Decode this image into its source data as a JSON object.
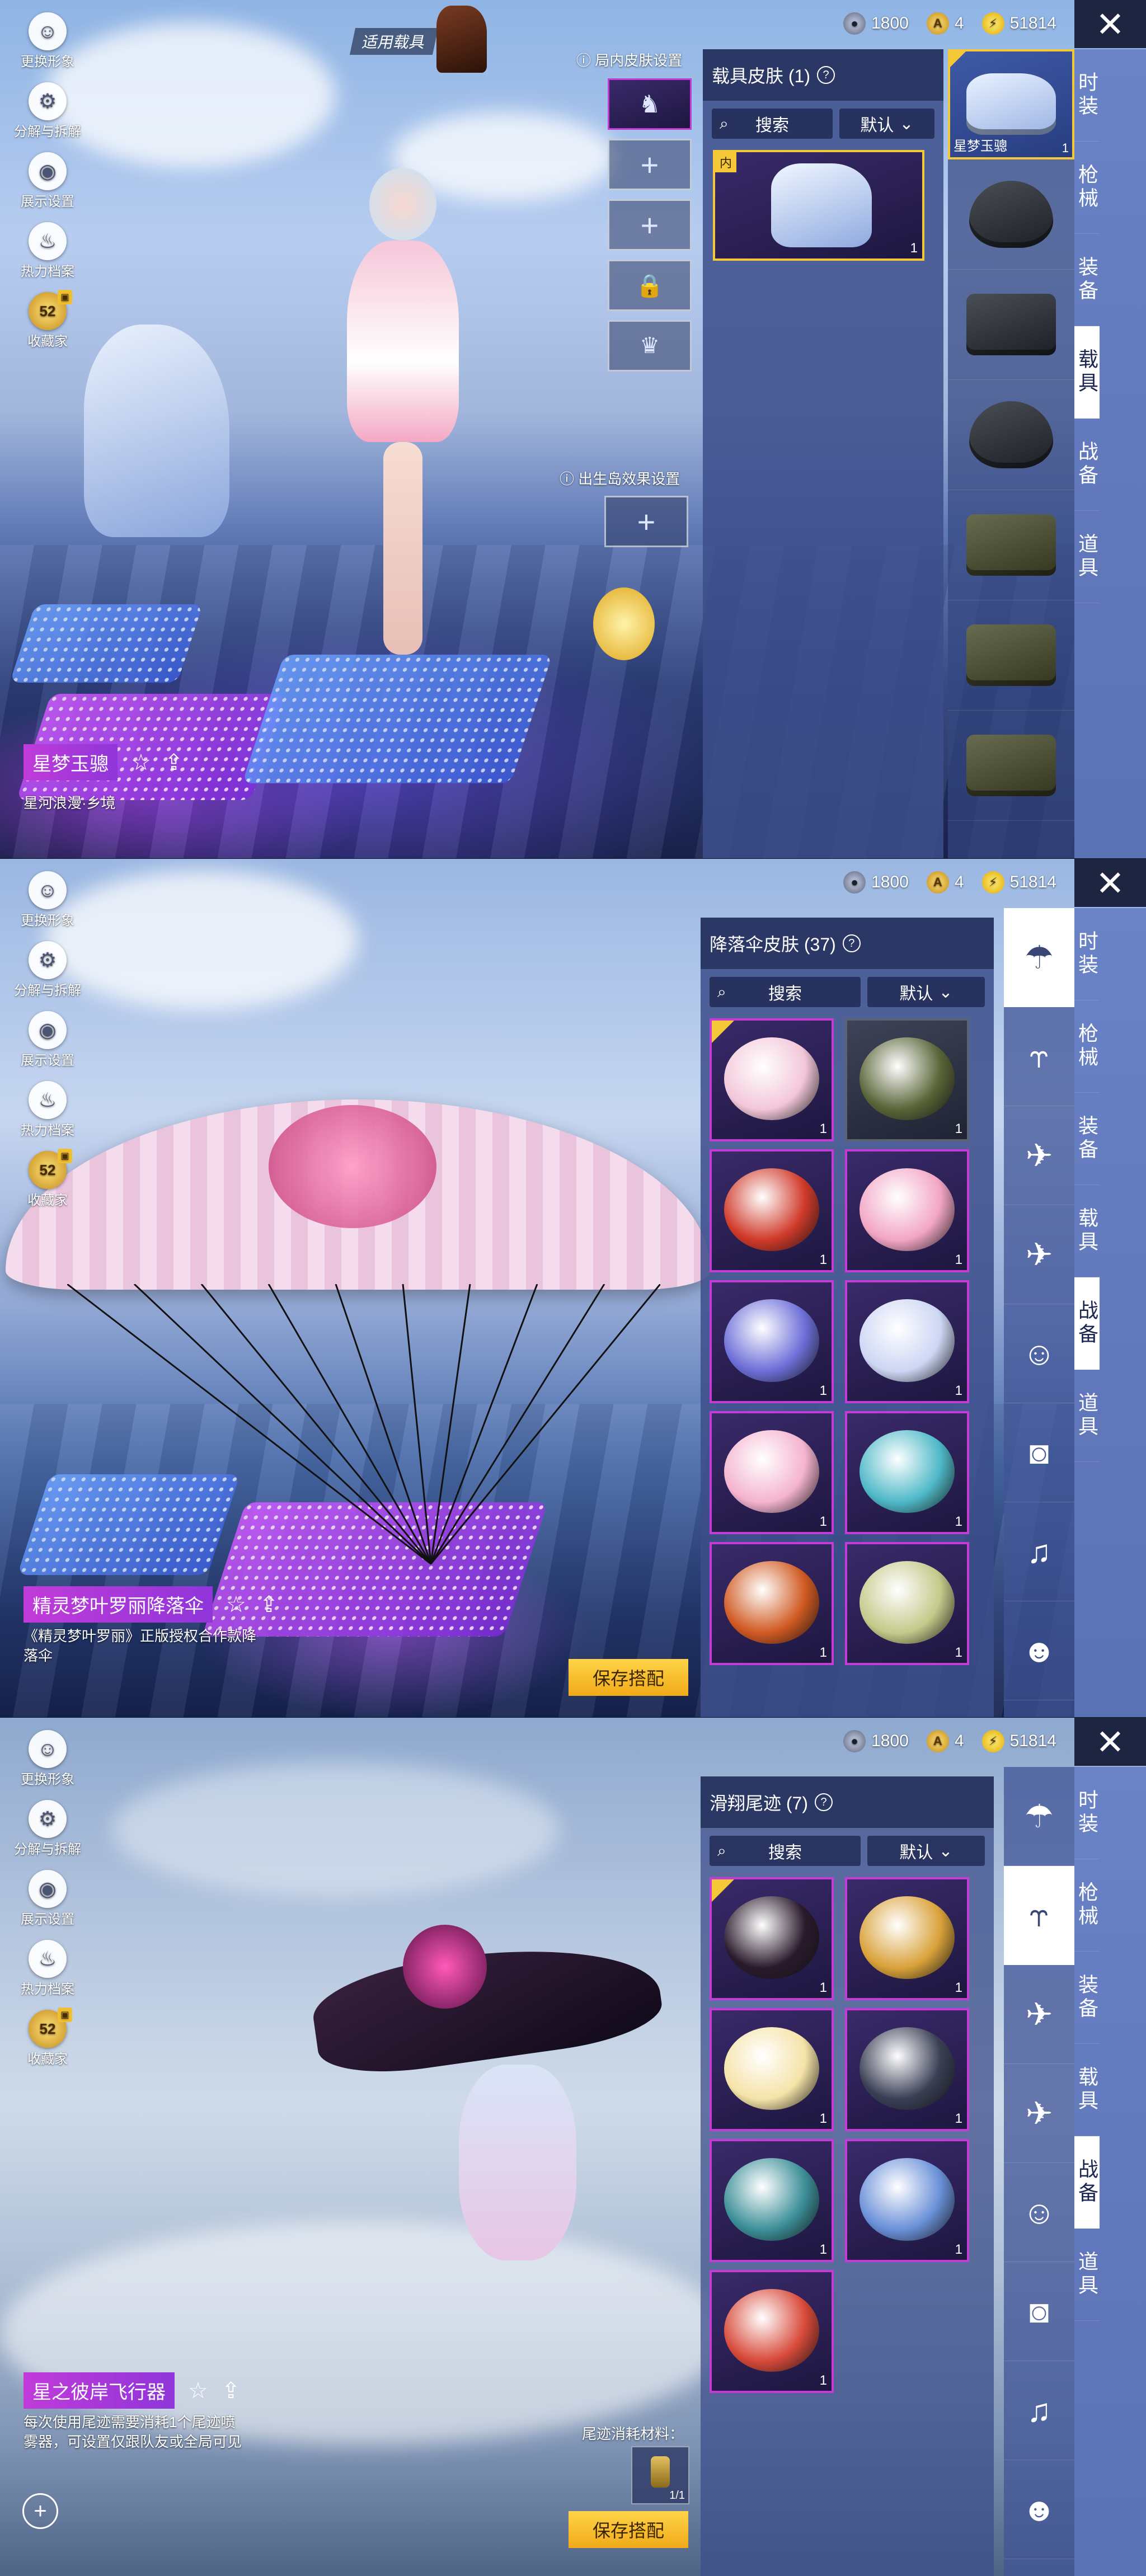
{
  "left_menu": [
    {
      "label": "更换形象",
      "icon": "person-icon"
    },
    {
      "label": "分解与拆解",
      "icon": "gear-icon"
    },
    {
      "label": "展示设置",
      "icon": "eye-icon"
    },
    {
      "label": "热力档案",
      "icon": "flame-icon"
    },
    {
      "label": "收藏家",
      "icon": "medal-icon",
      "badge_value": "52"
    }
  ],
  "currency": {
    "silver": "1800",
    "ag": "4",
    "uc": "51814"
  },
  "categories": [
    "时装",
    "枪械",
    "装备",
    "载具",
    "战备",
    "道具"
  ],
  "screen1": {
    "applicable_vehicle_label": "适用载具",
    "in_game_skin_label": "局内皮肤设置",
    "spawn_island_label": "出生岛效果设置",
    "panel_title": "载具皮肤 (1)",
    "search_placeholder": "搜索",
    "sort_label": "默认",
    "selected_item": {
      "tag": "内",
      "count": "1"
    },
    "vehicle_list": [
      {
        "name": "星梦玉骢",
        "count": "1"
      },
      {
        "name": "",
        "count": ""
      },
      {
        "name": "",
        "count": ""
      },
      {
        "name": "",
        "count": ""
      },
      {
        "name": "",
        "count": ""
      },
      {
        "name": "",
        "count": ""
      },
      {
        "name": "",
        "count": ""
      },
      {
        "name": "",
        "count": ""
      }
    ],
    "item_name": "星梦玉骢",
    "item_desc": "星河浪漫·乡境",
    "active_category": "载具"
  },
  "screen2": {
    "panel_title": "降落伞皮肤 (37)",
    "search_placeholder": "搜索",
    "sort_label": "默认",
    "items": [
      {
        "count": "1",
        "color": "#f3c7d9",
        "selected": true
      },
      {
        "count": "1",
        "color": "#5a6538"
      },
      {
        "count": "1",
        "color": "#d03a2a"
      },
      {
        "count": "1",
        "color": "#f2a6c4"
      },
      {
        "count": "1",
        "color": "#6d6fd8"
      },
      {
        "count": "1",
        "color": "#cdd6f4"
      },
      {
        "count": "1",
        "color": "#f4b4cf"
      },
      {
        "count": "1",
        "color": "#4fb9c8"
      },
      {
        "count": "1",
        "color": "#d05a22"
      },
      {
        "count": "1",
        "color": "#c5c98a"
      }
    ],
    "item_name": "精灵梦叶罗丽降落伞",
    "item_desc": "《精灵梦叶罗丽》正版授权合作款降落伞",
    "save_label": "保存搭配",
    "active_category": "战备"
  },
  "screen3": {
    "panel_title": "滑翔尾迹 (7)",
    "search_placeholder": "搜索",
    "sort_label": "默认",
    "items": [
      {
        "count": "1",
        "color": "#2a1a2c",
        "selected": true
      },
      {
        "count": "1",
        "color": "#d9a23a"
      },
      {
        "count": "1",
        "color": "#f5e3a8"
      },
      {
        "count": "1",
        "color": "#3a3f55"
      },
      {
        "count": "1",
        "color": "#3c8f98"
      },
      {
        "count": "1",
        "color": "#6a90d8"
      },
      {
        "count": "1",
        "color": "#d84a3a"
      }
    ],
    "item_name": "星之彼岸飞行器",
    "item_desc": "每次使用尾迹需要消耗1个尾迹喷雾器，可设置仅跟队友或全局可见",
    "material_label": "尾迹消耗材料：",
    "material_count": "1/1",
    "save_label": "保存搭配",
    "active_category": "战备"
  },
  "sub_icons": [
    "parachute-icon",
    "glider-icon",
    "drone-icon",
    "plane-icon",
    "emote-icon",
    "robot-icon",
    "speaker-icon",
    "face-icon",
    "gallery-icon"
  ],
  "accent_color": "#f5c838",
  "item_border_color": "#c43bd6"
}
